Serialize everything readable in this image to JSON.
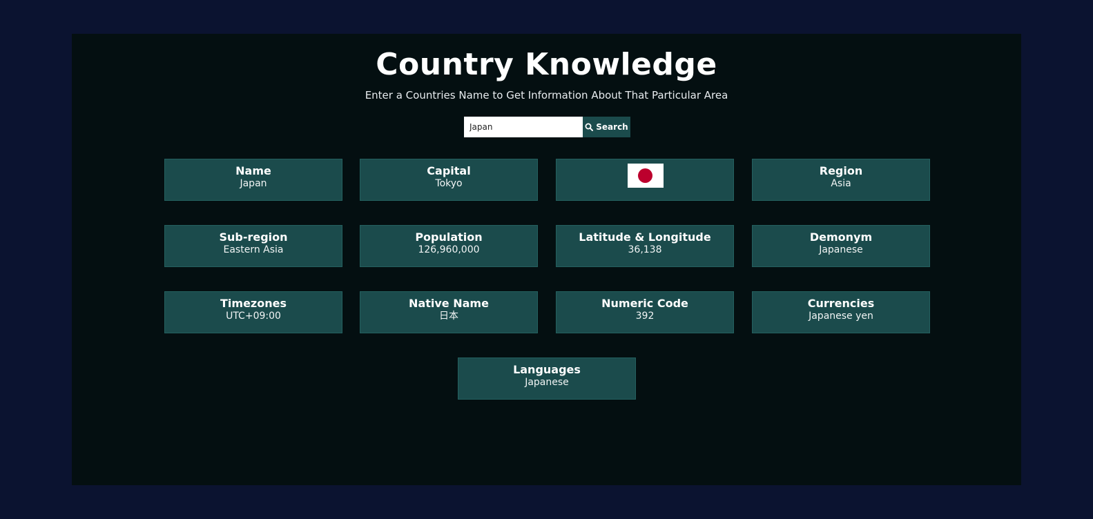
{
  "header": {
    "title": "Country Knowledge",
    "subtitle": "Enter a Countries Name to Get Information About That Particular Area"
  },
  "search": {
    "value": "Japan",
    "button_label": "Search",
    "button_icon": "search-icon"
  },
  "flag": {
    "icon": "japan-flag-icon",
    "field_color": "#ffffff",
    "disc_color": "#bc002d"
  },
  "cards": {
    "name": {
      "title": "Name",
      "value": "Japan"
    },
    "capital": {
      "title": "Capital",
      "value": "Tokyo"
    },
    "region": {
      "title": "Region",
      "value": "Asia"
    },
    "subregion": {
      "title": "Sub-region",
      "value": "Eastern Asia"
    },
    "population": {
      "title": "Population",
      "value": "126,960,000"
    },
    "latlng": {
      "title": "Latitude & Longitude",
      "value": "36,138"
    },
    "demonym": {
      "title": "Demonym",
      "value": "Japanese"
    },
    "timezones": {
      "title": "Timezones",
      "value": "UTC+09:00"
    },
    "native_name": {
      "title": "Native Name",
      "value": "日本"
    },
    "numeric_code": {
      "title": "Numeric Code",
      "value": "392"
    },
    "currencies": {
      "title": "Currencies",
      "value": "Japanese yen"
    },
    "languages": {
      "title": "Languages",
      "value": "Japanese"
    }
  },
  "colors": {
    "page_background": "#0b1330",
    "panel_background": "#040f11",
    "card_background": "#1b4b4c",
    "text": "#ffffff"
  }
}
